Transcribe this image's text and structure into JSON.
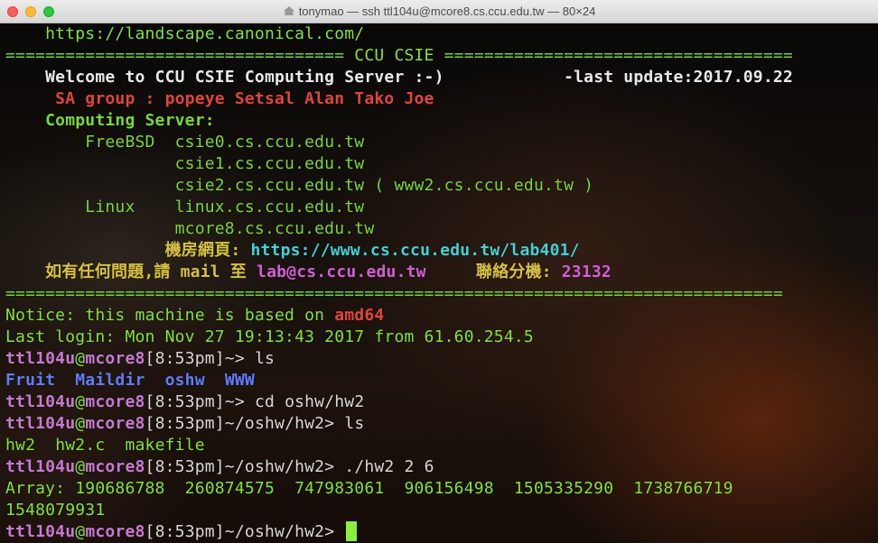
{
  "window": {
    "title": "tonymao — ssh ttl104u@mcore8.cs.ccu.edu.tw — 80×24"
  },
  "terminal": {
    "url_line": "    https://landscape.canonical.com/",
    "sep_left": "==================================",
    "sep_title": " CCU CSIE ",
    "sep_right": "===================================",
    "welcome": "    Welcome to CCU CSIE Computing Server :-)            ",
    "last_update": "-last update:2017.09.22",
    "sa_group": "     SA group : popeye Setsal Alan Tako Joe",
    "computing_server": "    Computing Server:",
    "freebsd_label": "        FreeBSD  ",
    "csie0": "csie0.cs.ccu.edu.tw",
    "csie1": "                 csie1.cs.ccu.edu.tw",
    "csie2": "                 csie2.cs.ccu.edu.tw ( www2.cs.ccu.edu.tw )",
    "linux_label": "        Linux    ",
    "linux_host": "linux.cs.ccu.edu.tw",
    "mcore8": "                 mcore8.cs.ccu.edu.tw",
    "lab_label": "                機房網頁: ",
    "lab_url": "https://www.cs.ccu.edu.tw/lab401/",
    "help_text": "    如有任何問題,請 mail 至 ",
    "help_mail": "lab@cs.ccu.edu.tw",
    "ext_label": "     聯絡分機: ",
    "ext_number": "23132",
    "sep_full": "==============================================================================",
    "notice": "Notice: this machine is based on ",
    "notice_arch": "amd64",
    "last_login": "Last login: Mon Nov 27 19:13:43 2017 from 61.60.254.5",
    "user": "ttl104u",
    "at": "@",
    "host": "mcore8",
    "time": "[8:53pm]",
    "cmd1": "~> ls",
    "ls_items": [
      "Fruit",
      "Maildir",
      "oshw",
      "WWW"
    ],
    "cmd2": "~> cd oshw/hw2",
    "cmd3": "~/oshw/hw2> ls",
    "ls2_items": [
      "hw2",
      "hw2.c",
      "makefile"
    ],
    "cmd4": "~/oshw/hw2> ./hw2 2 6",
    "array_line": "Array: 190686788  260874575  747983061  906156498  1505335290  1738766719",
    "array_wrap": "1548079931",
    "prompt_tail": "~/oshw/hw2> "
  },
  "colors": {
    "green": "#83e33b",
    "red": "#e0463a",
    "yellow": "#d7c23c",
    "cyan": "#3fd3d7",
    "magenta": "#d35fd6",
    "blue": "#5d7dff",
    "cursor": "#8af03a"
  }
}
